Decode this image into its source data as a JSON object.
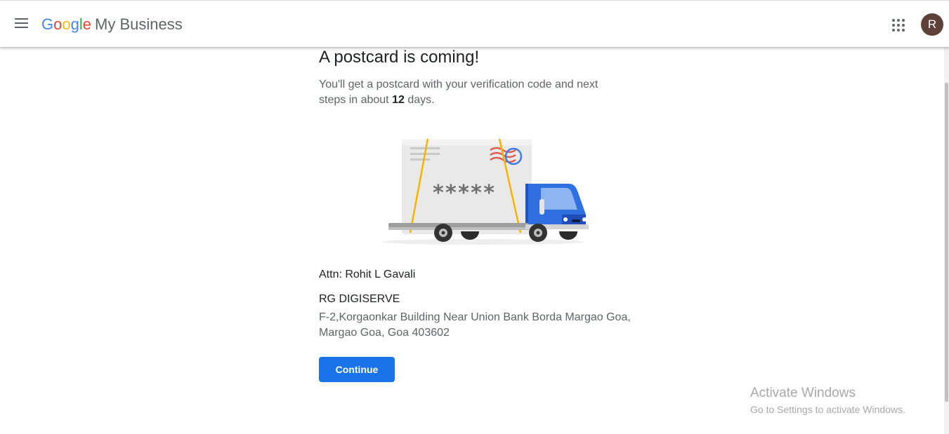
{
  "header": {
    "logo_letters": [
      "G",
      "o",
      "o",
      "g",
      "l",
      "e"
    ],
    "product_name": "My Business",
    "avatar_letter": "R",
    "menu_icon": "hamburger-menu-icon",
    "apps_icon": "apps-grid-icon"
  },
  "main": {
    "title": "A postcard is coming!",
    "subtitle_before": "You'll get a postcard with your verification code and next steps in about ",
    "subtitle_days": "12",
    "subtitle_after": " days.",
    "illustration": {
      "masked_code": "*****",
      "icon": "postcard-delivery-truck-illustration"
    },
    "attn": "Attn: Rohit L Gavali",
    "business_name": "RG DIGISERVE",
    "address_line1": "F-2,Korgaonkar Building Near Union Bank Borda Margao Goa,",
    "address_line2": "Margao Goa, Goa 403602",
    "continue_label": "Continue"
  },
  "watermark": {
    "title": "Activate Windows",
    "subtitle": "Go to Settings to activate Windows."
  },
  "colors": {
    "primary": "#1a73e8",
    "avatar_bg": "#5d4037",
    "google_blue": "#4285f4",
    "google_red": "#ea4335",
    "google_yellow": "#fbbc05",
    "google_green": "#34a853"
  }
}
